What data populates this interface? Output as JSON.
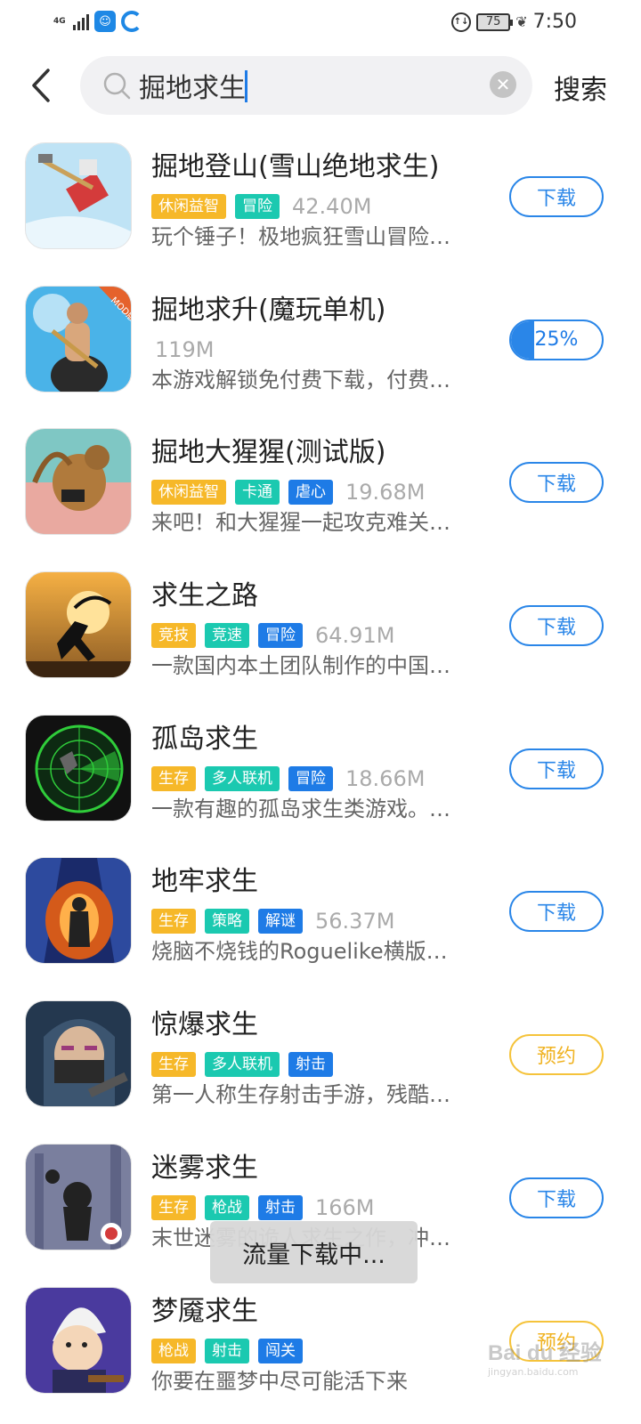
{
  "status_bar": {
    "network": "4G",
    "battery": "75",
    "time": "7:50"
  },
  "search": {
    "query": "掘地求生",
    "search_label": "搜索"
  },
  "results": [
    {
      "title": "掘地登山(雪山绝地求生)",
      "tags": [
        {
          "label": "休闲益智",
          "color": "#f6b829"
        },
        {
          "label": "冒险",
          "color": "#1bc9b0"
        }
      ],
      "size": "42.40M",
      "desc": "玩个锤子！极地疯狂雪山冒险…",
      "action": "下载",
      "action_type": "download"
    },
    {
      "title": "掘地求升(魔玩单机)",
      "tags": [],
      "size": "119M",
      "desc": "本游戏解锁免付费下载，付费…",
      "action": "25%",
      "action_type": "progress",
      "progress": 0.25
    },
    {
      "title": "掘地大猩猩(测试版)",
      "tags": [
        {
          "label": "休闲益智",
          "color": "#f6b829"
        },
        {
          "label": "卡通",
          "color": "#1bc9b0"
        },
        {
          "label": "虐心",
          "color": "#1e7be6"
        }
      ],
      "size": "19.68M",
      "desc": "来吧！和大猩猩一起攻克难关…",
      "action": "下载",
      "action_type": "download"
    },
    {
      "title": "求生之路",
      "tags": [
        {
          "label": "竞技",
          "color": "#f6b829"
        },
        {
          "label": "竞速",
          "color": "#1bc9b0"
        },
        {
          "label": "冒险",
          "color": "#1e7be6"
        }
      ],
      "size": "64.91M",
      "desc": "一款国内本土团队制作的中国…",
      "action": "下载",
      "action_type": "download"
    },
    {
      "title": "孤岛求生",
      "tags": [
        {
          "label": "生存",
          "color": "#f6b829"
        },
        {
          "label": "多人联机",
          "color": "#1bc9b0"
        },
        {
          "label": "冒险",
          "color": "#1e7be6"
        }
      ],
      "size": "18.66M",
      "desc": "一款有趣的孤岛求生类游戏。…",
      "action": "下载",
      "action_type": "download"
    },
    {
      "title": "地牢求生",
      "tags": [
        {
          "label": "生存",
          "color": "#f6b829"
        },
        {
          "label": "策略",
          "color": "#1bc9b0"
        },
        {
          "label": "解谜",
          "color": "#1e7be6"
        }
      ],
      "size": "56.37M",
      "desc": "烧脑不烧钱的Roguelike横版…",
      "action": "下载",
      "action_type": "download"
    },
    {
      "title": "惊爆求生",
      "tags": [
        {
          "label": "生存",
          "color": "#f6b829"
        },
        {
          "label": "多人联机",
          "color": "#1bc9b0"
        },
        {
          "label": "射击",
          "color": "#1e7be6"
        }
      ],
      "size": "",
      "desc": "第一人称生存射击手游，残酷…",
      "action": "预约",
      "action_type": "reserve"
    },
    {
      "title": "迷雾求生",
      "tags": [
        {
          "label": "生存",
          "color": "#f6b829"
        },
        {
          "label": "枪战",
          "color": "#1bc9b0"
        },
        {
          "label": "射击",
          "color": "#1e7be6"
        }
      ],
      "size": "166M",
      "desc": "末世迷雾的诡人求生之作，冲…",
      "action": "下载",
      "action_type": "download"
    },
    {
      "title": "梦魇求生",
      "tags": [
        {
          "label": "枪战",
          "color": "#f6b829"
        },
        {
          "label": "射击",
          "color": "#1bc9b0"
        },
        {
          "label": "闯关",
          "color": "#1e7be6"
        }
      ],
      "size": "",
      "desc": "你要在噩梦中尽可能活下来",
      "action": "预约",
      "action_type": "reserve"
    }
  ],
  "toast": "流量下载中...",
  "watermark": {
    "main": "Bai du 经验",
    "sub": "jingyan.baidu.com"
  }
}
